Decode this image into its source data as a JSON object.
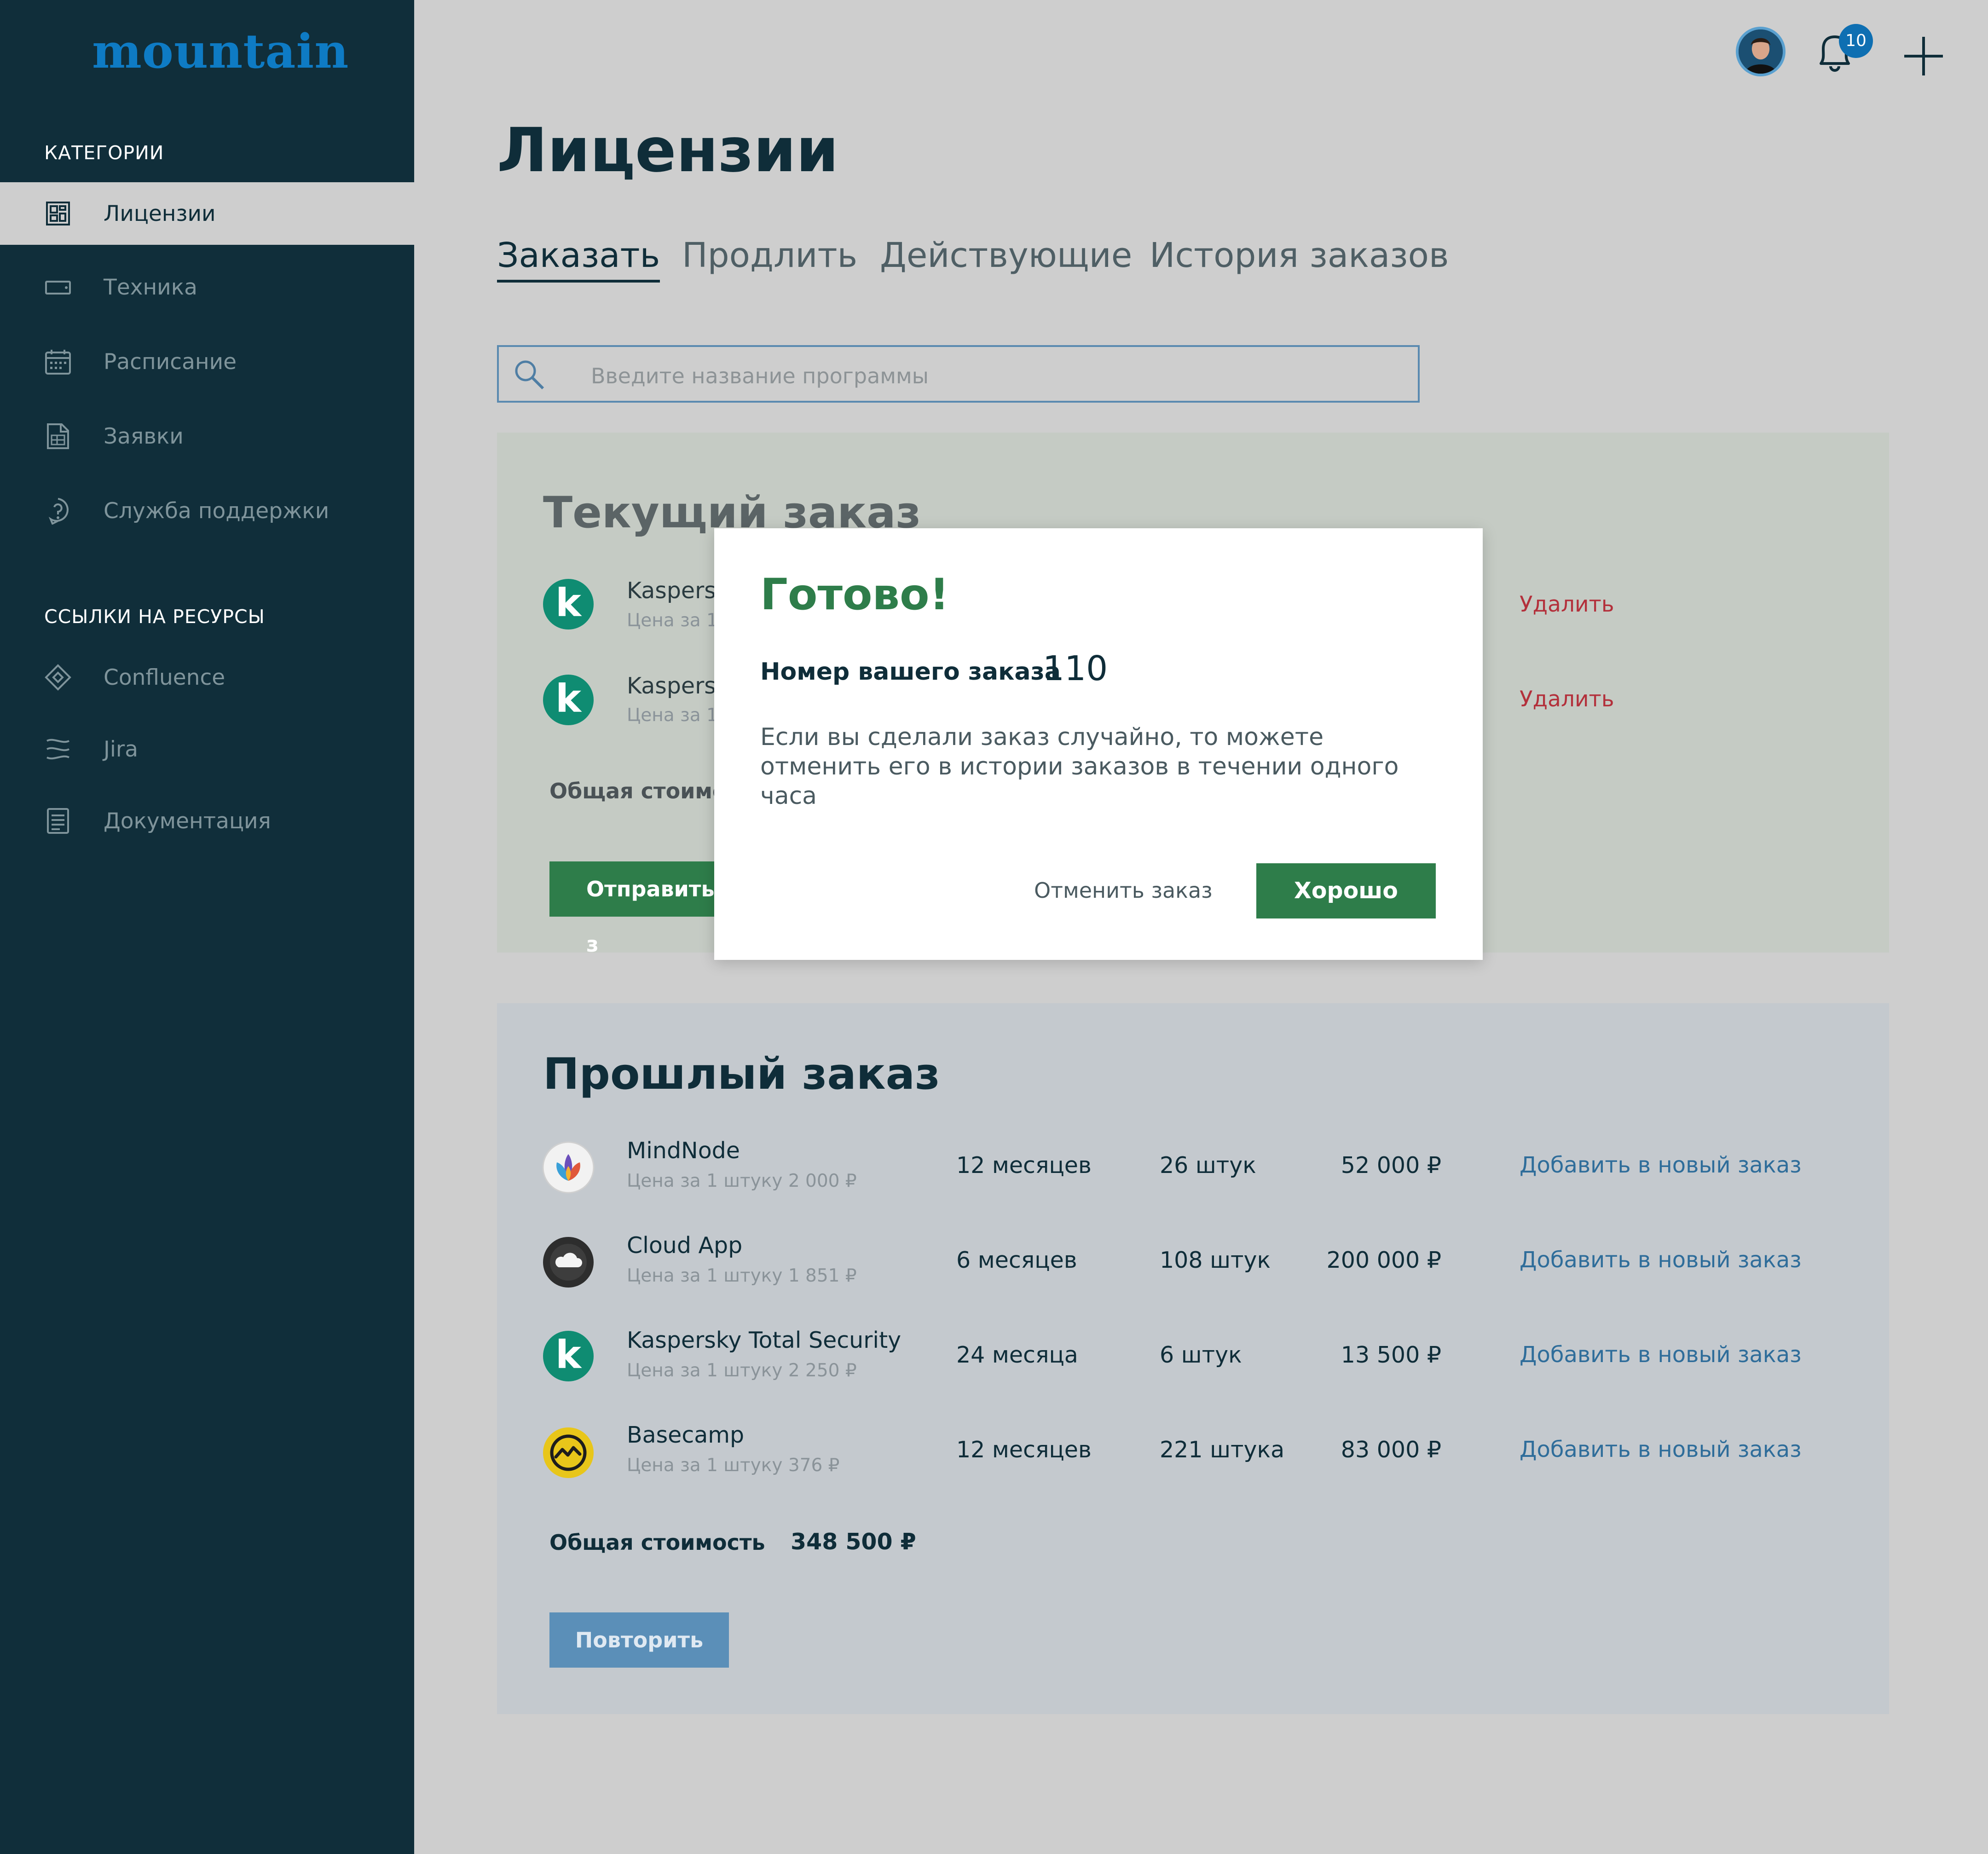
{
  "app": {
    "logo": "mountain"
  },
  "sidebar": {
    "section_categories": "КАТЕГОРИИ",
    "categories": [
      {
        "label": "Лицензии",
        "icon": "license-icon",
        "active": true
      },
      {
        "label": "Техника",
        "icon": "device-icon"
      },
      {
        "label": "Расписание",
        "icon": "calendar-icon"
      },
      {
        "label": "Заявки",
        "icon": "requests-icon"
      },
      {
        "label": "Служба поддержки",
        "icon": "support-icon"
      }
    ],
    "section_resources": "ССЫЛКИ НА РЕСУРСЫ",
    "resources": [
      {
        "label": "Confluence",
        "icon": "confluence-icon"
      },
      {
        "label": "Jira",
        "icon": "jira-icon"
      },
      {
        "label": "Документация",
        "icon": "docs-icon"
      }
    ]
  },
  "topbar": {
    "notifications_count": "10"
  },
  "page": {
    "title": "Лицензии",
    "tabs": [
      {
        "label": "Заказать",
        "active": true
      },
      {
        "label": "Продлить"
      },
      {
        "label": "Действующие"
      },
      {
        "label": "История заказов"
      }
    ],
    "search_placeholder": "Введите название программы"
  },
  "current_order": {
    "title": "Текущий заказ",
    "items": [
      {
        "name": "Kaspersk",
        "price": "Цена за 1",
        "action": "Удалить"
      },
      {
        "name": "Kaspersk",
        "price": "Цена за 1",
        "action": "Удалить"
      }
    ],
    "total_label": "Общая стоимос",
    "submit_label": "Отправить з"
  },
  "past_order": {
    "title": "Прошлый заказ",
    "items": [
      {
        "name": "MindNode",
        "price": "Цена за 1 штуку 2 000 ₽",
        "period": "12 месяцев",
        "qty": "26 штук",
        "sum": "52 000 ₽",
        "action": "Добавить в новый заказ",
        "logo": "mindnode"
      },
      {
        "name": "Cloud App",
        "price": "Цена за 1 штуку 1 851 ₽",
        "period": "6 месяцев",
        "qty": "108 штук",
        "sum": "200 000 ₽",
        "action": "Добавить в новый заказ",
        "logo": "cloudapp"
      },
      {
        "name": "Kaspersky Total Security",
        "price": "Цена за 1 штуку 2 250 ₽",
        "period": "24 месяца",
        "qty": "6 штук",
        "sum": "13 500 ₽",
        "action": "Добавить в новый заказ",
        "logo": "kaspersky"
      },
      {
        "name": "Basecamp",
        "price": "Цена за 1 штуку 376 ₽",
        "period": "12 месяцев",
        "qty": "221 штука",
        "sum": "83 000 ₽",
        "action": "Добавить в новый заказ",
        "logo": "basecamp"
      }
    ],
    "total_label": "Общая стоимость",
    "total_value": "348 500 ₽",
    "repeat_label": "Повторить"
  },
  "modal": {
    "title": "Готово!",
    "order_label": "Номер вашего заказа",
    "order_number": "110",
    "message": "Если вы сделали заказ случайно, то можете отменить его в истории заказов в течении одного часа",
    "cancel_label": "Отменить заказ",
    "ok_label": "Хорошо"
  },
  "colors": {
    "sidebar_bg": "#102e3a",
    "logo": "#0e7bc4",
    "accent_green": "#2e7d4a",
    "link_blue": "#2f6d9a",
    "delete_red": "#b3303b",
    "repeat_btn": "#5b8fb8"
  }
}
